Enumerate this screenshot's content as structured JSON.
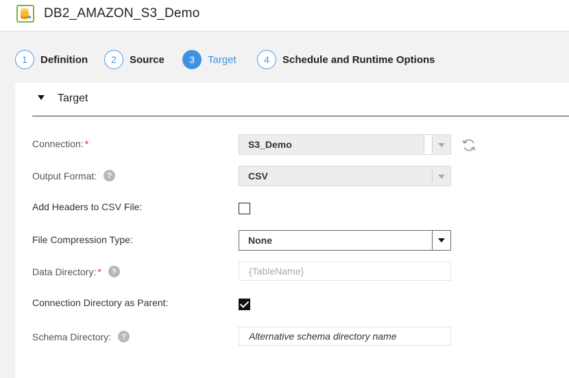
{
  "window": {
    "title": "DB2_AMAZON_S3_Demo"
  },
  "steps": [
    {
      "num": "1",
      "label": "Definition"
    },
    {
      "num": "2",
      "label": "Source"
    },
    {
      "num": "3",
      "label": "Target"
    },
    {
      "num": "4",
      "label": "Schedule and Runtime Options"
    }
  ],
  "active_step": "Target",
  "section": {
    "title": "Target"
  },
  "form": {
    "connection": {
      "label": "Connection:",
      "required_mark": "*",
      "value": "S3_Demo"
    },
    "output_format": {
      "label": "Output Format:",
      "help": "?",
      "value": "CSV"
    },
    "add_headers": {
      "label": "Add Headers to CSV File:",
      "checked": false
    },
    "compression": {
      "label": "File Compression Type:",
      "value": "None"
    },
    "data_directory": {
      "label": "Data Directory:",
      "required_mark": "*",
      "help": "?",
      "placeholder": "{TableName}"
    },
    "conn_dir_parent": {
      "label": "Connection Directory as Parent:",
      "checked": true
    },
    "schema_directory": {
      "label": "Schema Directory:",
      "help": "?",
      "placeholder": "Alternative schema directory name"
    }
  },
  "colors": {
    "accent": "#3f92e3",
    "required": "#d42b2b",
    "brand_icon": "#7cb342"
  },
  "icons": [
    "database-task-icon",
    "refresh-icon",
    "help-icon",
    "caret-down-icon",
    "dropdown-arrow-icon"
  ]
}
